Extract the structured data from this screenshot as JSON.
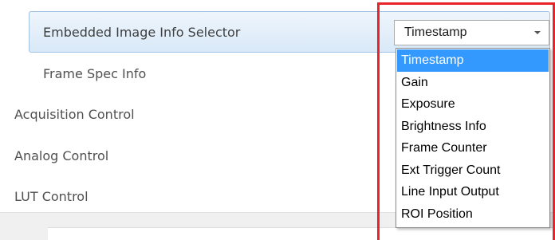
{
  "properties": {
    "embedded_label": "Embedded Image Info Selector",
    "frame_spec_label": "Frame Spec Info",
    "acquisition_label": "Acquisition Control",
    "analog_label": "Analog Control",
    "lut_label": "LUT Control"
  },
  "combo": {
    "value": "Timestamp",
    "options": [
      "Timestamp",
      "Gain",
      "Exposure",
      "Brightness Info",
      "Frame Counter",
      "Ext Trigger Count",
      "Line Input Output",
      "ROI Position"
    ],
    "selected_index": 0
  },
  "colors": {
    "highlight_border": "#e8232a",
    "selection": "#3399ff",
    "row_selected": "#d9e9f8"
  },
  "icons": {
    "dropdown_arrow": "chevron-down-icon"
  }
}
